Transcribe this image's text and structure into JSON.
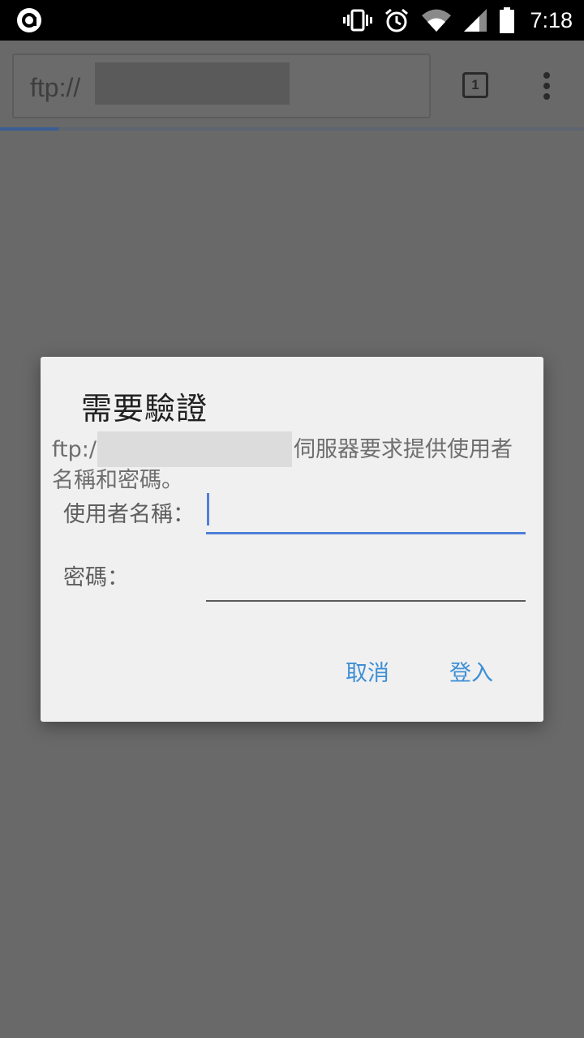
{
  "status_bar": {
    "time": "7:18",
    "icons": [
      "notification-app-icon",
      "vibrate-icon",
      "alarm-icon",
      "wifi-icon",
      "cellular-signal-icon",
      "battery-icon"
    ]
  },
  "toolbar": {
    "url_text": "ftp://",
    "tab_count": "1",
    "menu_icon": "overflow-menu-icon",
    "load_progress": 0.1
  },
  "dialog": {
    "title": "需要驗證",
    "message_url_prefix": "ftp:/",
    "message_suffix": "伺服器要求提供使用者",
    "message_line2": "名稱和密碼。",
    "username_label": "使用者名稱：",
    "username_value": "",
    "password_label": "密碼：",
    "password_value": "",
    "cancel_label": "取消",
    "login_label": "登入"
  },
  "colors": {
    "accent": "#3d8fd6",
    "focus_underline": "#4f7fd8",
    "scrim": "#696969",
    "dialog_bg": "#f0f0f0"
  }
}
